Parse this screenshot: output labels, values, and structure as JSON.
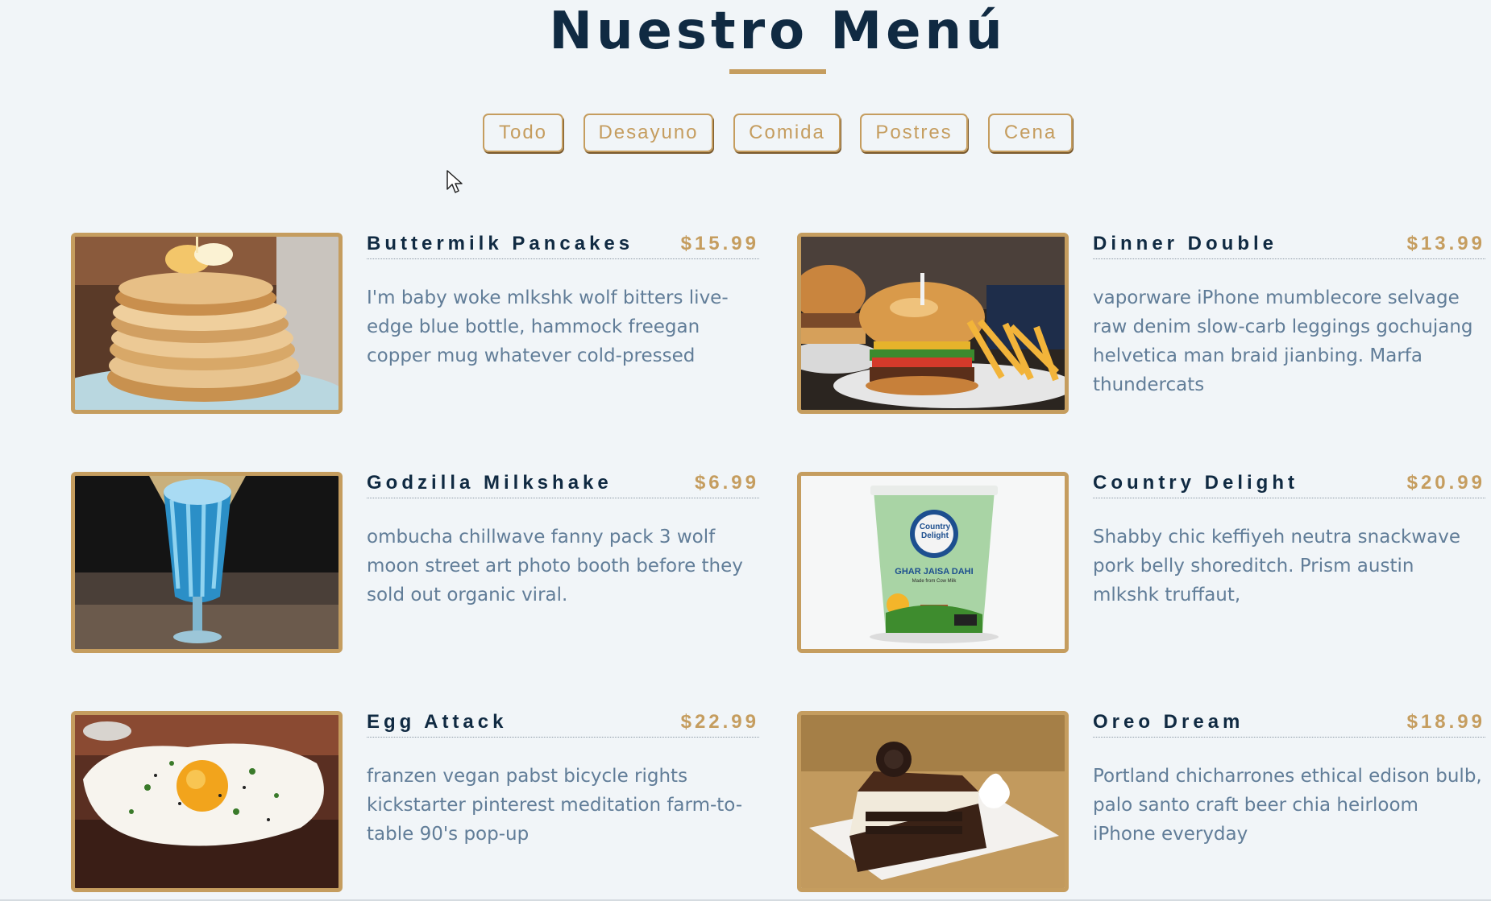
{
  "page": {
    "title": "Nuestro Menú",
    "accent_color": "#c59d5f",
    "text_color": "#102a42",
    "desc_color": "#617d98"
  },
  "filters": [
    {
      "label": "Todo"
    },
    {
      "label": "Desayuno"
    },
    {
      "label": "Comida"
    },
    {
      "label": "Postres"
    },
    {
      "label": "Cena"
    }
  ],
  "items": [
    {
      "name": "Buttermilk Pancakes",
      "price": "$15.99",
      "description": "I'm baby woke mlkshk wolf bitters live-edge blue bottle, hammock freegan copper mug whatever cold-pressed",
      "image": "pancakes-photo"
    },
    {
      "name": "Dinner Double",
      "price": "$13.99",
      "description": "vaporware iPhone mumblecore selvage raw denim slow-carb leggings gochujang helvetica man braid jianbing. Marfa thundercats",
      "image": "burger-photo"
    },
    {
      "name": "Godzilla Milkshake",
      "price": "$6.99",
      "description": "ombucha chillwave fanny pack 3 wolf moon street art photo booth before they sold out organic viral.",
      "image": "milkshake-photo"
    },
    {
      "name": "Country Delight",
      "price": "$20.99",
      "description": "Shabby chic keffiyeh neutra snackwave pork belly shoreditch. Prism austin mlkshk truffaut,",
      "image": "yogurt-cup-photo"
    },
    {
      "name": "Egg Attack",
      "price": "$22.99",
      "description": "franzen vegan pabst bicycle rights kickstarter pinterest meditation farm-to-table 90's pop-up",
      "image": "fried-egg-toast-photo"
    },
    {
      "name": "Oreo Dream",
      "price": "$18.99",
      "description": "Portland chicharrones ethical edison bulb, palo santo craft beer chia heirloom iPhone everyday",
      "image": "oreo-cheesecake-photo"
    }
  ],
  "cup_label": {
    "brand": "Country Delight",
    "tagline": "GHAR JAISA DAHI",
    "subtext": "Made from Cow Milk"
  }
}
